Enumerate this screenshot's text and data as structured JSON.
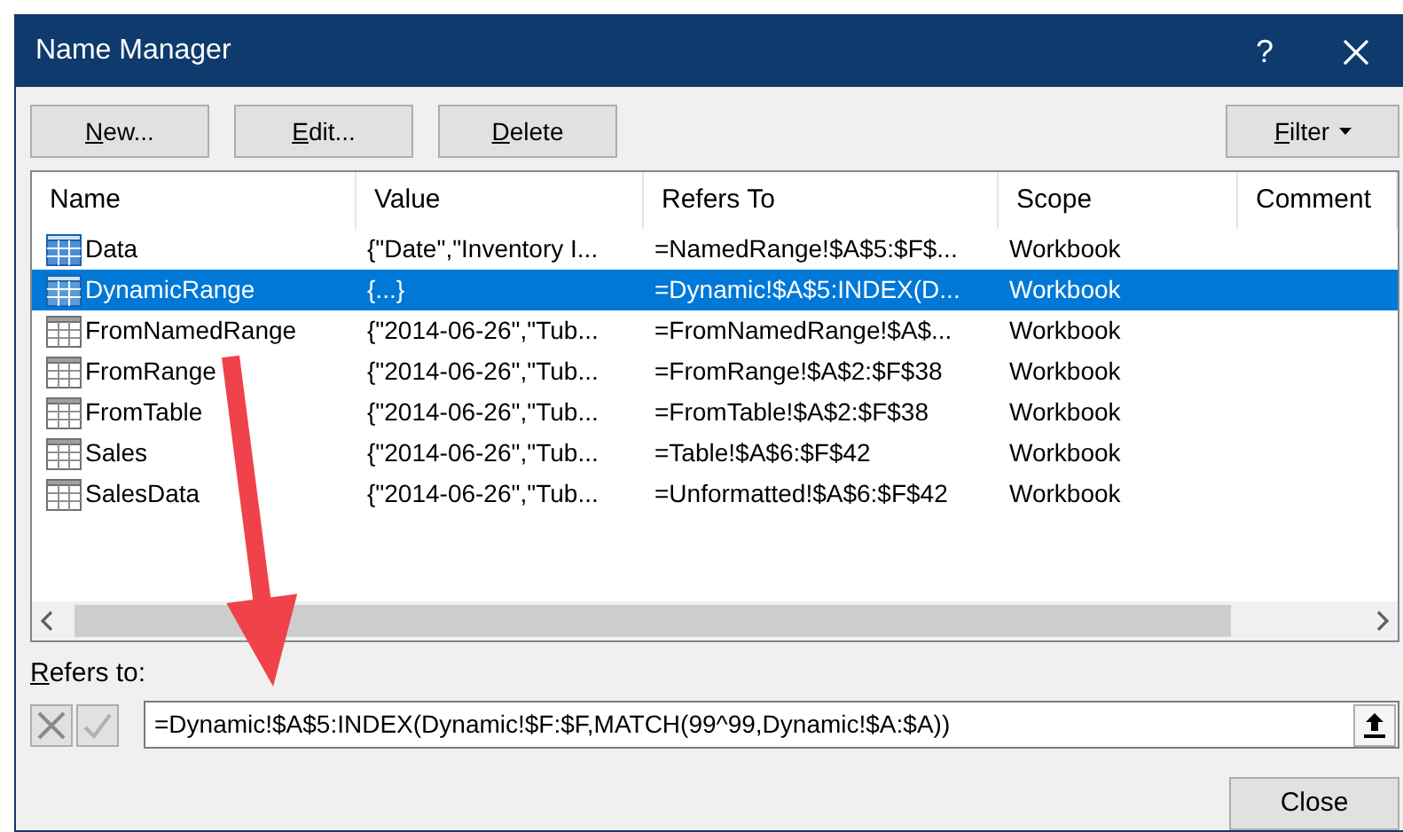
{
  "window": {
    "title": "Name Manager",
    "help": "?"
  },
  "buttons": [
    {
      "label": "New...",
      "mnemonic": true
    },
    {
      "label": "Edit...",
      "mnemonic": true
    },
    {
      "label": "Delete",
      "mnemonic": true
    }
  ],
  "filter_button": {
    "label": "Filter",
    "mnemonic": true
  },
  "table": {
    "columns": [
      "Name",
      "Value",
      "Refers To",
      "Scope",
      "Comment"
    ],
    "rows": [
      {
        "kind": "range",
        "selected": false,
        "cells": [
          "Data",
          "{\"Date\",\"Inventory I...",
          "=NamedRange!$A$5:$F$...",
          "Workbook"
        ]
      },
      {
        "kind": "range",
        "selected": true,
        "cells": [
          "DynamicRange",
          "{...}",
          "=Dynamic!$A$5:INDEX(D...",
          "Workbook"
        ]
      },
      {
        "kind": "table",
        "selected": false,
        "cells": [
          "FromNamedRange",
          "{\"2014-06-26\",\"Tub...",
          "=FromNamedRange!$A$...",
          "Workbook"
        ]
      },
      {
        "kind": "table",
        "selected": false,
        "cells": [
          "FromRange",
          "{\"2014-06-26\",\"Tub...",
          "=FromRange!$A$2:$F$38",
          "Workbook"
        ]
      },
      {
        "kind": "table",
        "selected": false,
        "cells": [
          "FromTable",
          "{\"2014-06-26\",\"Tub...",
          "=FromTable!$A$2:$F$38",
          "Workbook"
        ]
      },
      {
        "kind": "table",
        "selected": false,
        "cells": [
          "Sales",
          "{\"2014-06-26\",\"Tub...",
          "=Table!$A$6:$F$42",
          "Workbook"
        ]
      },
      {
        "kind": "table",
        "selected": false,
        "cells": [
          "SalesData",
          "{\"2014-06-26\",\"Tub...",
          "=Unformatted!$A$6:$F$42",
          "Workbook"
        ]
      }
    ]
  },
  "refers_to": {
    "label": "Refers to:",
    "value": "=Dynamic!$A$5:INDEX(Dynamic!$F:$F,MATCH(99^99,Dynamic!$A:$A))"
  },
  "close_button": {
    "label": "Close"
  }
}
